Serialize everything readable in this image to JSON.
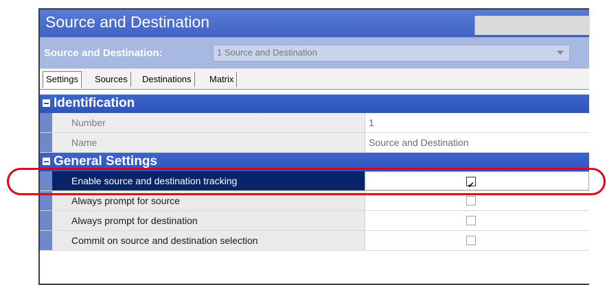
{
  "window": {
    "title": "Source and Destination"
  },
  "selector": {
    "label": "Source and Destination:",
    "value": "1 Source and Destination"
  },
  "tabs": [
    {
      "label": "Settings",
      "active": true
    },
    {
      "label": "Sources",
      "active": false
    },
    {
      "label": "Destinations",
      "active": false
    },
    {
      "label": "Matrix",
      "active": false
    }
  ],
  "sections": {
    "identification": {
      "title": "Identification",
      "rows": [
        {
          "name": "Number",
          "value": "1"
        },
        {
          "name": "Name",
          "value": "Source and Destination"
        }
      ]
    },
    "general": {
      "title": "General Settings",
      "rows": [
        {
          "name": "Enable source and destination tracking",
          "checked": true
        },
        {
          "name": "Always prompt for source",
          "checked": false
        },
        {
          "name": "Always prompt for destination",
          "checked": false
        },
        {
          "name": "Commit on source and destination selection",
          "checked": false
        }
      ]
    }
  },
  "colors": {
    "title_bar": "#4a6fd0",
    "section_header": "#3460c4",
    "selected_row": "#0a246a",
    "highlight_annotation": "#e1001a"
  }
}
